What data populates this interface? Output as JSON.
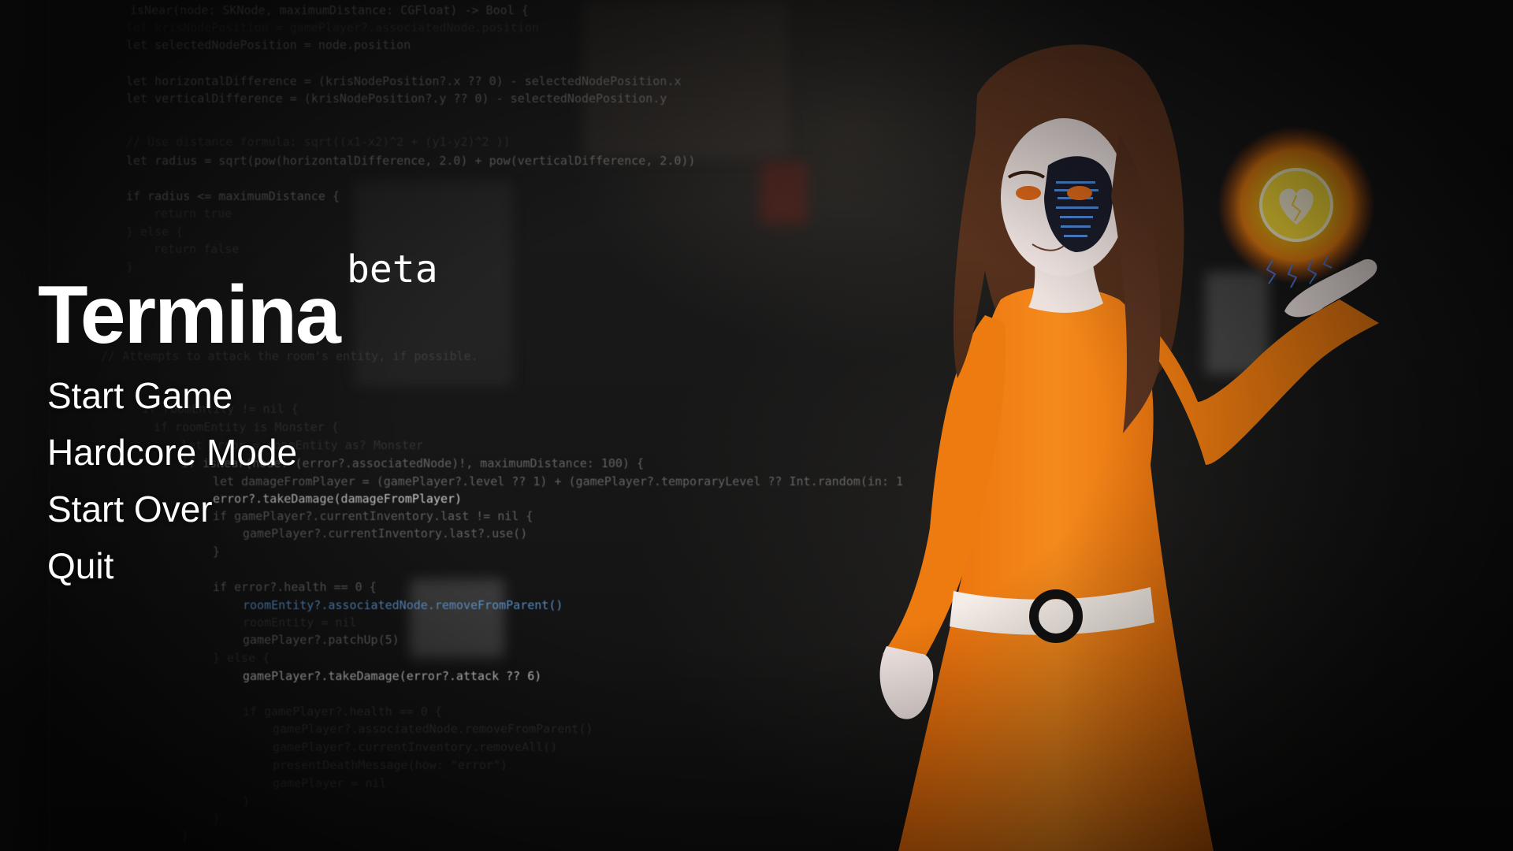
{
  "title": "Termina",
  "badge": "beta",
  "menu": [
    {
      "label": "Start Game"
    },
    {
      "label": "Hardcore Mode"
    },
    {
      "label": "Start Over"
    },
    {
      "label": "Quit"
    }
  ],
  "background_code": [
    "isNear(node: SKNode, maximumDistance: CGFloat) -> Bool {",
    "let krisNodePosition = gamePlayer?.associatedNode.position",
    "let selectedNodePosition = node.position",
    "let horizontalDifference = (krisNodePosition?.x ?? 0) - selectedNodePosition.x",
    "let verticalDifference = (krisNodePosition?.y ?? 0) - selectedNodePosition.y",
    "// Use distance formula: sqrt((x1-x2)^2 + (y1-y2)^2 ))",
    "let radius = sqrt(pow(horizontalDifference, 2.0) + pow(verticalDifference, 2.0))",
    "if radius <= maximumDistance {",
    "return true",
    "} else {",
    "return false",
    "}",
    "// Attempts to attack the room's entity, if possible.",
    "if roomEntity != nil {",
    "if roomEntity is Monster {",
    "let error = roomEntity as? Monster",
    "if isNear(node: (error?.associatedNode)!, maximumDistance: 100) {",
    "let damageFromPlayer = (gamePlayer?.level ?? 1) + (gamePlayer?.temporaryLevel ?? Int.random(in: 1",
    "error?.takeDamage(damageFromPlayer)",
    "if gamePlayer?.currentInventory.last != nil {",
    "gamePlayer?.currentInventory.last?.use()",
    "}",
    "if error?.health == 0 {",
    "roomEntity?.associatedNode.removeFromParent()",
    "roomEntity = nil",
    "gamePlayer?.patchUp(5)",
    "} else {",
    "gamePlayer?.takeDamage(error?.attack ?? 6)",
    "if gamePlayer?.health == 0 {",
    "gamePlayer?.associatedNode.removeFromParent()",
    "gamePlayer?.currentInventory.removeAll()",
    "presentDeathMessage(how: \"error\")",
    "gamePlayer = nil",
    "}",
    "}",
    "}"
  ],
  "colors": {
    "text": "#ffffff",
    "dress": "#f07a12",
    "hair": "#5a3320",
    "skin": "#f1e6e3",
    "orb": "#ffb21a"
  }
}
